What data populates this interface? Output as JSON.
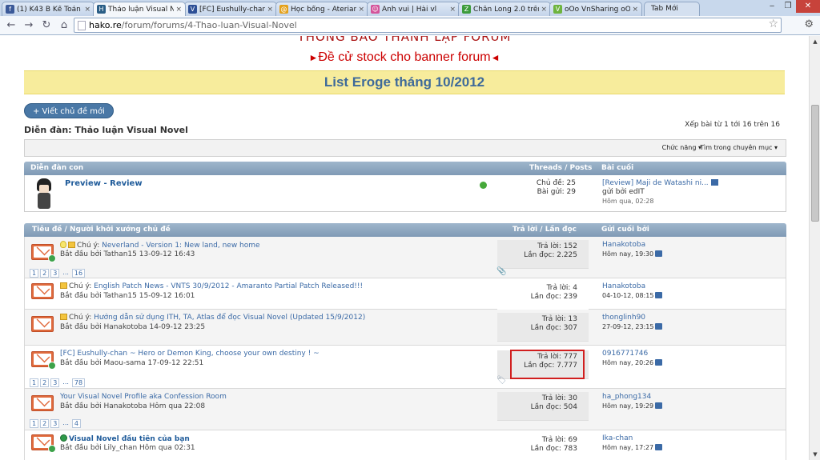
{
  "browser": {
    "tabs": [
      {
        "label": "(1) K43 B Kế Toán",
        "icon_color": "#3b5998",
        "icon": "f"
      },
      {
        "label": "Thảo luận Visual N",
        "icon_color": "#2a5e86",
        "icon": "H"
      },
      {
        "label": "[FC] Eushully-chan",
        "icon_color": "#2d4f96",
        "icon": "V"
      },
      {
        "label": "Học bổng - Aterian",
        "icon_color": "#e4a11b",
        "icon": "@"
      },
      {
        "label": "Ảnh vui | Hài vl",
        "icon_color": "#d4549a",
        "icon": "☺"
      },
      {
        "label": "Chân Long 2.0 trên",
        "icon_color": "#3c9c3c",
        "icon": "Z"
      },
      {
        "label": "oOo VnSharing oO",
        "icon_color": "#6eb43f",
        "icon": "V"
      }
    ],
    "new_tab_label": "Tab Mới",
    "url_domain": "hako.re",
    "url_path": "/forum/forums/4-Thao-luan-Visual-Novel"
  },
  "page": {
    "cut_text": "THÔNG BÁO THÀNH LẬP FORUM",
    "banner_line": "Đề cử stock cho banner forum",
    "yellow_bar": "List Eroge tháng 10/2012",
    "new_thread_button": "+ Viết chủ đề mới",
    "forum_title": "Diễn đàn: Thảo luận Visual Novel",
    "pagination": "Xếp bài từ 1 tới 16 trên 16",
    "controls": {
      "features": "Chức năng ▾",
      "search": "Tìm trong chuyên mục ▾"
    },
    "subforum_header": {
      "col1": "Diễn đàn con",
      "col2": "Threads / Posts",
      "col3": "Bài cuối"
    },
    "subforum": {
      "title": "Preview - Review",
      "threads": "Chủ đề: 25",
      "posts": "Bài gửi: 29",
      "last_title": "[Review] Maji de Watashi ni...",
      "last_by": "gửi bởi edIT",
      "last_time": "Hôm qua, 02:28"
    },
    "threads_header": {
      "col1": "Tiêu đề / Người khởi xướng chủ đề",
      "col2": "Trả lời / Lần đọc",
      "col3": "Gửi cuối bởi"
    },
    "threads": [
      {
        "prefix": "Chú ý:",
        "title": "Neverland - Version 1: New land, new home",
        "starter": "Bắt đầu bởi Tathan15 13-09-12 16:43",
        "replies": "Trả lời: 152",
        "views": "Lần đọc: 2.225",
        "last_user": "Hanakotoba",
        "last_time": "Hôm nay, 19:30",
        "pages": [
          "1",
          "2",
          "3",
          "...",
          "16"
        ]
      },
      {
        "prefix": "Chú ý:",
        "title": "English Patch News - VNTS 30/9/2012 - Amaranto Partial Patch Released!!!",
        "starter": "Bắt đầu bởi Tathan15 15-09-12 16:01",
        "replies": "Trả lời: 4",
        "views": "Lần đọc: 239",
        "last_user": "Hanakotoba",
        "last_time": "04-10-12, 08:15"
      },
      {
        "prefix": "Chú ý:",
        "title": "Hướng dẫn sử dụng ITH, TA, Atlas để đọc Visual Novel (Updated 15/9/2012)",
        "starter": "Bắt đầu bởi Hanakotoba 14-09-12 23:25",
        "replies": "Trả lời: 13",
        "views": "Lần đọc: 307",
        "last_user": "thonglinh90",
        "last_time": "27-09-12, 23:15"
      },
      {
        "prefix": "",
        "title": "[FC] Eushully-chan ~ Hero or Demon King, choose your own destiny ! ~",
        "starter": "Bắt đầu bởi Maou-sama 17-09-12 22:51",
        "replies": "Trả lời: 777",
        "views": "Lần đọc: 7.777",
        "last_user": "0916771746",
        "last_time": "Hôm nay, 20:26",
        "pages": [
          "1",
          "2",
          "3",
          "...",
          "78"
        ]
      },
      {
        "prefix": "",
        "title": "Your Visual Novel Profile aka Confession Room",
        "starter": "Bắt đầu bởi Hanakotoba Hôm qua 22:08",
        "replies": "Trả lời: 30",
        "views": "Lần đọc: 504",
        "last_user": "ha_phong134",
        "last_time": "Hôm nay, 19:29",
        "pages": [
          "1",
          "2",
          "3",
          "...",
          "4"
        ]
      },
      {
        "prefix": "",
        "title": "Visual Novel đầu tiên của bạn",
        "starter": "Bắt đầu bởi Lily_chan Hôm qua 02:31",
        "replies": "Trả lời: 69",
        "views": "Lần đọc: 783",
        "last_user": "Ika-chan",
        "last_time": "Hôm nay, 17:27"
      }
    ]
  },
  "colors": {
    "accent": "#3b6aa6",
    "header_bar": "#8aa4bf",
    "highlight": "#d11f1f",
    "banner": "#cc0000"
  }
}
